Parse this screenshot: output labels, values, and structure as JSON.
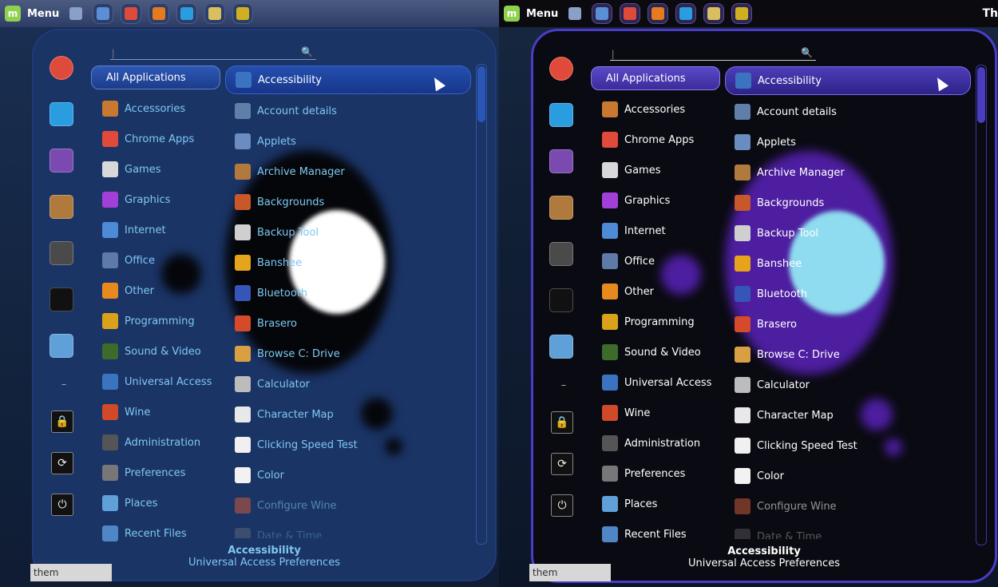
{
  "taskbar": {
    "menu_label": "Menu",
    "right_clock_fragment": "Th",
    "launchers": [
      "show-desktop-icon",
      "files-icon",
      "chrome-icon",
      "firefox-icon",
      "skype-icon",
      "clapper-icon",
      "system-monitor-icon"
    ]
  },
  "search": {
    "value": "",
    "placeholder": "|"
  },
  "favorites": [
    "chrome-icon",
    "skype-icon",
    "viber-icon",
    "archive-icon",
    "settings-icon",
    "terminal-icon",
    "folder-icon",
    "separator",
    "lock-icon",
    "logout-icon",
    "power-icon"
  ],
  "categories": [
    {
      "label": "All Applications",
      "icon": "none",
      "color": ""
    },
    {
      "label": "Accessories",
      "icon": "accessories-icon",
      "color": "#c9782f"
    },
    {
      "label": "Chrome Apps",
      "icon": "chrome-icon",
      "color": "#e04a3a"
    },
    {
      "label": "Games",
      "icon": "games-icon",
      "color": "#d8d8d8"
    },
    {
      "label": "Graphics",
      "icon": "graphics-icon",
      "color": "#a23fd8"
    },
    {
      "label": "Internet",
      "icon": "internet-icon",
      "color": "#4d8bd6"
    },
    {
      "label": "Office",
      "icon": "office-icon",
      "color": "#5d7aa8"
    },
    {
      "label": "Other",
      "icon": "other-icon",
      "color": "#e68a1f"
    },
    {
      "label": "Programming",
      "icon": "programming-icon",
      "color": "#d9a21a"
    },
    {
      "label": "Sound & Video",
      "icon": "sound-video-icon",
      "color": "#3d6b2a"
    },
    {
      "label": "Universal Access",
      "icon": "universal-access-icon",
      "color": "#3a73c0"
    },
    {
      "label": "Wine",
      "icon": "wine-icon",
      "color": "#d04a2a"
    },
    {
      "label": "Administration",
      "icon": "administration-icon",
      "color": "#555555"
    },
    {
      "label": "Preferences",
      "icon": "preferences-icon",
      "color": "#777777"
    },
    {
      "label": "Places",
      "icon": "places-icon",
      "color": "#5fa0d8"
    },
    {
      "label": "Recent Files",
      "icon": "recent-files-icon",
      "color": "#4f86c6"
    }
  ],
  "apps": [
    {
      "label": "Accessibility",
      "icon": "accessibility-icon",
      "color": "#3a73c0"
    },
    {
      "label": "Account details",
      "icon": "account-icon",
      "color": "#5f7fa8"
    },
    {
      "label": "Applets",
      "icon": "applets-icon",
      "color": "#6b8cc0"
    },
    {
      "label": "Archive Manager",
      "icon": "archive-icon",
      "color": "#b07a3c"
    },
    {
      "label": "Backgrounds",
      "icon": "backgrounds-icon",
      "color": "#c8572a"
    },
    {
      "label": "Backup Tool",
      "icon": "backup-icon",
      "color": "#cfcfcf"
    },
    {
      "label": "Banshee",
      "icon": "banshee-icon",
      "color": "#e6a41c"
    },
    {
      "label": "Bluetooth",
      "icon": "bluetooth-icon",
      "color": "#3556b8"
    },
    {
      "label": "Brasero",
      "icon": "brasero-icon",
      "color": "#d44a2a"
    },
    {
      "label": "Browse C: Drive",
      "icon": "drive-icon",
      "color": "#d9a043"
    },
    {
      "label": "Calculator",
      "icon": "calculator-icon",
      "color": "#bcbcbc"
    },
    {
      "label": "Character Map",
      "icon": "character-map-icon",
      "color": "#e8e8e8"
    },
    {
      "label": "Clicking Speed Test",
      "icon": "speed-test-icon",
      "color": "#f0f0f0"
    },
    {
      "label": "Color",
      "icon": "color-icon",
      "color": "#f2f2f2"
    },
    {
      "label": "Configure Wine",
      "icon": "configure-wine-icon",
      "color": "#c85a3a"
    },
    {
      "label": "Date & Time",
      "icon": "date-time-icon",
      "color": "#888888"
    }
  ],
  "description": {
    "title": "Accessibility",
    "subtitle": "Universal Access Preferences"
  },
  "bottom_tag": "them",
  "themes": {
    "left": {
      "accent": "#1b3466"
    },
    "right": {
      "accent": "#4a3cc8"
    }
  }
}
